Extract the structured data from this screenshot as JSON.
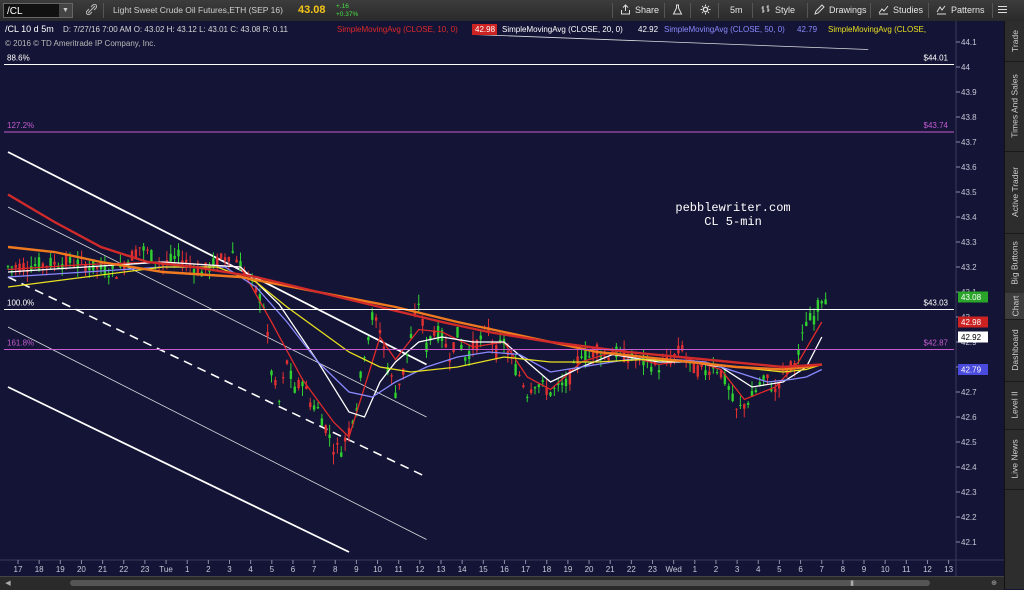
{
  "toolbar": {
    "symbol": "/CL",
    "description": "Light Sweet Crude Oil Futures,ETH (SEP 16)",
    "last": "43.08",
    "change": "+.16",
    "change_pct": "+0.37%",
    "buttons": {
      "share": "Share",
      "interval": "5m",
      "style": "Style",
      "drawings": "Drawings",
      "studies": "Studies",
      "patterns": "Patterns"
    }
  },
  "sidebar": {
    "items": [
      "Trade",
      "Times And Sales",
      "Active Trader",
      "Big Buttons",
      "Chart",
      "Dashboard",
      "Level II",
      "Live News"
    ]
  },
  "chart_data": {
    "type": "candlestick",
    "header_text": "/CL 10 d 5m",
    "ohlc": "D: 7/27/16 7:00 AM   O: 43.02   H: 43.12   L: 43.01   C: 43.08   R: 0.11",
    "copyright": "© 2016 © TD Ameritrade IP Company, Inc.",
    "annotation": [
      "pebblewriter.com",
      "CL 5-min"
    ],
    "studies": [
      {
        "label": "SimpleMovingAvg (CLOSE, 10, 0)",
        "value": "42.98",
        "color": "#e02a2a"
      },
      {
        "label": "SimpleMovingAvg (CLOSE, 20, 0)",
        "value": "42.92",
        "color": "#ffffff"
      },
      {
        "label": "SimpleMovingAvg (CLOSE, 50, 0)",
        "value": "42.79",
        "color": "#8a8aff"
      },
      {
        "label": "SimpleMovingAvg (CLOSE,",
        "value": "",
        "color": "#e8e020"
      }
    ],
    "ylim": [
      42.0,
      44.2
    ],
    "y_ticks": [
      "44.1",
      "44",
      "43.9",
      "43.8",
      "43.7",
      "43.6",
      "43.5",
      "43.4",
      "43.3",
      "43.2",
      "43.1",
      "43",
      "42.9",
      "42.8",
      "42.7",
      "42.6",
      "42.5",
      "42.4",
      "42.3",
      "42.2",
      "42.1"
    ],
    "x_ticks": [
      "17",
      "18",
      "19",
      "20",
      "21",
      "22",
      "23",
      "Tue",
      "1",
      "2",
      "3",
      "4",
      "5",
      "6",
      "7",
      "8",
      "9",
      "10",
      "11",
      "12",
      "13",
      "14",
      "15",
      "16",
      "17",
      "18",
      "19",
      "20",
      "21",
      "22",
      "23",
      "Wed",
      "1",
      "2",
      "3",
      "4",
      "5",
      "6",
      "7",
      "8",
      "9",
      "10",
      "11",
      "12",
      "13"
    ],
    "fib_levels": [
      {
        "pct": "88.6%",
        "price": "$44.01",
        "value": 44.01,
        "color": "#ffffff"
      },
      {
        "pct": "127.2%",
        "price": "$43.74",
        "value": 43.74,
        "color": "#c45ccf"
      },
      {
        "pct": "100.0%",
        "price": "$43.03",
        "value": 43.03,
        "color": "#ffffff"
      },
      {
        "pct": "161.8%",
        "price": "$42.87",
        "value": 42.87,
        "color": "#c45ccf"
      }
    ],
    "price_markers": [
      {
        "value": 43.08,
        "label": "43.08",
        "bg": "#2aa52a",
        "fg": "#ffffff"
      },
      {
        "value": 42.98,
        "label": "42.98",
        "bg": "#cc2222",
        "fg": "#ffffff"
      },
      {
        "value": 42.92,
        "label": "42.92",
        "bg": "#ffffff",
        "fg": "#000000"
      },
      {
        "value": 42.79,
        "label": "42.79",
        "bg": "#4a4adf",
        "fg": "#ffffff"
      }
    ],
    "close_path": [
      [
        0,
        43.2
      ],
      [
        8,
        43.22
      ],
      [
        14,
        43.18
      ],
      [
        17,
        43.28
      ],
      [
        20,
        43.21
      ],
      [
        22,
        43.24
      ],
      [
        25,
        43.18
      ],
      [
        29,
        43.26
      ],
      [
        31,
        43.16
      ],
      [
        33,
        43.05
      ],
      [
        34,
        42.78
      ],
      [
        35,
        42.66
      ],
      [
        36,
        42.82
      ],
      [
        37,
        42.7
      ],
      [
        38,
        42.75
      ],
      [
        39,
        42.66
      ],
      [
        40,
        42.63
      ],
      [
        41,
        42.56
      ],
      [
        42,
        42.48
      ],
      [
        43,
        42.47
      ],
      [
        44,
        42.55
      ],
      [
        45,
        42.65
      ],
      [
        46,
        42.86
      ],
      [
        47,
        43.0
      ],
      [
        48,
        42.95
      ],
      [
        49,
        42.8
      ],
      [
        50,
        42.7
      ],
      [
        51,
        42.78
      ],
      [
        52,
        42.92
      ],
      [
        53,
        43.06
      ],
      [
        54,
        42.88
      ],
      [
        55,
        42.95
      ],
      [
        56,
        42.92
      ],
      [
        57,
        42.85
      ],
      [
        58,
        42.93
      ],
      [
        59,
        42.84
      ],
      [
        60,
        42.88
      ],
      [
        61,
        42.91
      ],
      [
        62,
        42.95
      ],
      [
        63,
        42.86
      ],
      [
        64,
        42.9
      ],
      [
        65,
        42.82
      ],
      [
        66,
        42.77
      ],
      [
        67,
        42.7
      ],
      [
        68,
        42.74
      ],
      [
        70,
        42.7
      ],
      [
        72,
        42.73
      ],
      [
        73,
        42.79
      ],
      [
        74,
        42.86
      ],
      [
        75,
        42.84
      ],
      [
        76,
        42.88
      ],
      [
        77,
        42.84
      ],
      [
        78,
        42.86
      ],
      [
        80,
        42.84
      ],
      [
        82,
        42.82
      ],
      [
        84,
        42.8
      ],
      [
        86,
        42.84
      ],
      [
        87,
        42.88
      ],
      [
        88,
        42.8
      ],
      [
        90,
        42.78
      ],
      [
        91,
        42.81
      ],
      [
        92,
        42.78
      ],
      [
        93,
        42.71
      ],
      [
        94,
        42.62
      ],
      [
        95,
        42.65
      ],
      [
        96,
        42.68
      ],
      [
        97,
        42.73
      ],
      [
        98,
        42.75
      ],
      [
        99,
        42.7
      ],
      [
        100,
        42.78
      ],
      [
        101,
        42.8
      ],
      [
        102,
        42.85
      ],
      [
        103,
        42.98
      ],
      [
        104,
        43.0
      ],
      [
        105,
        43.08
      ]
    ],
    "moving_averages": [
      {
        "name": "SMA 10",
        "color": "#e02a2a",
        "points": [
          [
            0,
            43.19
          ],
          [
            10,
            43.21
          ],
          [
            20,
            43.22
          ],
          [
            30,
            43.2
          ],
          [
            34,
            42.98
          ],
          [
            38,
            42.75
          ],
          [
            42,
            42.58
          ],
          [
            44,
            42.52
          ],
          [
            46,
            42.72
          ],
          [
            48,
            42.92
          ],
          [
            50,
            42.83
          ],
          [
            53,
            42.95
          ],
          [
            56,
            42.94
          ],
          [
            60,
            42.88
          ],
          [
            64,
            42.9
          ],
          [
            67,
            42.76
          ],
          [
            70,
            42.71
          ],
          [
            74,
            42.82
          ],
          [
            78,
            42.86
          ],
          [
            84,
            42.81
          ],
          [
            88,
            42.83
          ],
          [
            92,
            42.79
          ],
          [
            95,
            42.67
          ],
          [
            99,
            42.72
          ],
          [
            102,
            42.82
          ],
          [
            105,
            42.98
          ]
        ]
      },
      {
        "name": "SMA 20",
        "color": "#ffffff",
        "points": [
          [
            0,
            43.18
          ],
          [
            10,
            43.2
          ],
          [
            20,
            43.22
          ],
          [
            30,
            43.2
          ],
          [
            35,
            43.05
          ],
          [
            40,
            42.82
          ],
          [
            44,
            42.62
          ],
          [
            46,
            42.6
          ],
          [
            48,
            42.74
          ],
          [
            50,
            42.82
          ],
          [
            53,
            42.9
          ],
          [
            56,
            42.92
          ],
          [
            60,
            42.9
          ],
          [
            64,
            42.9
          ],
          [
            67,
            42.82
          ],
          [
            70,
            42.74
          ],
          [
            74,
            42.8
          ],
          [
            78,
            42.85
          ],
          [
            84,
            42.82
          ],
          [
            88,
            42.82
          ],
          [
            92,
            42.8
          ],
          [
            96,
            42.72
          ],
          [
            100,
            42.74
          ],
          [
            103,
            42.8
          ],
          [
            105,
            42.92
          ]
        ]
      },
      {
        "name": "SMA 50",
        "color": "#8a8aff",
        "points": [
          [
            0,
            43.16
          ],
          [
            10,
            43.18
          ],
          [
            20,
            43.2
          ],
          [
            28,
            43.2
          ],
          [
            32,
            43.12
          ],
          [
            36,
            42.98
          ],
          [
            40,
            42.82
          ],
          [
            44,
            42.7
          ],
          [
            47,
            42.68
          ],
          [
            50,
            42.74
          ],
          [
            54,
            42.8
          ],
          [
            58,
            42.84
          ],
          [
            62,
            42.86
          ],
          [
            66,
            42.85
          ],
          [
            70,
            42.78
          ],
          [
            74,
            42.8
          ],
          [
            80,
            42.83
          ],
          [
            86,
            42.83
          ],
          [
            90,
            42.82
          ],
          [
            94,
            42.78
          ],
          [
            98,
            42.74
          ],
          [
            101,
            42.75
          ],
          [
            103,
            42.76
          ],
          [
            105,
            42.79
          ]
        ]
      },
      {
        "name": "SMA yellow",
        "color": "#e8e020",
        "points": [
          [
            0,
            43.12
          ],
          [
            10,
            43.16
          ],
          [
            20,
            43.2
          ],
          [
            27,
            43.2
          ],
          [
            32,
            43.14
          ],
          [
            36,
            43.04
          ],
          [
            40,
            42.95
          ],
          [
            44,
            42.86
          ],
          [
            48,
            42.8
          ],
          [
            52,
            42.78
          ],
          [
            58,
            42.8
          ],
          [
            64,
            42.84
          ],
          [
            70,
            42.82
          ],
          [
            76,
            42.82
          ],
          [
            82,
            42.83
          ],
          [
            88,
            42.82
          ],
          [
            94,
            42.8
          ],
          [
            100,
            42.78
          ],
          [
            103,
            42.79
          ],
          [
            105,
            42.81
          ]
        ]
      },
      {
        "name": "SMA orange",
        "color": "#f07a20",
        "points": [
          [
            0,
            43.28
          ],
          [
            6,
            43.26
          ],
          [
            12,
            43.22
          ],
          [
            20,
            43.18
          ],
          [
            30,
            43.16
          ],
          [
            40,
            43.1
          ],
          [
            50,
            43.04
          ],
          [
            58,
            42.98
          ],
          [
            64,
            42.94
          ],
          [
            70,
            42.9
          ],
          [
            76,
            42.86
          ],
          [
            82,
            42.84
          ],
          [
            88,
            42.82
          ],
          [
            94,
            42.8
          ],
          [
            100,
            42.79
          ],
          [
            103,
            42.8
          ],
          [
            105,
            42.81
          ]
        ]
      },
      {
        "name": "SMA red",
        "color": "#d02a2a",
        "points": [
          [
            0,
            43.49
          ],
          [
            6,
            43.38
          ],
          [
            12,
            43.28
          ],
          [
            18,
            43.22
          ],
          [
            24,
            43.2
          ],
          [
            32,
            43.16
          ],
          [
            40,
            43.1
          ],
          [
            48,
            43.04
          ],
          [
            56,
            42.98
          ],
          [
            62,
            42.94
          ],
          [
            70,
            42.9
          ],
          [
            80,
            42.86
          ],
          [
            90,
            42.83
          ],
          [
            100,
            42.8
          ],
          [
            105,
            42.81
          ]
        ]
      }
    ],
    "trend_lines": [
      {
        "kind": "solid",
        "color": "#ffffff",
        "points": [
          [
            0,
            43.66
          ],
          [
            54,
            42.81
          ]
        ]
      },
      {
        "kind": "thin",
        "color": "#ffffff",
        "points": [
          [
            0,
            43.44
          ],
          [
            54,
            42.6
          ]
        ]
      },
      {
        "kind": "dashed",
        "color": "#ffffff",
        "points": [
          [
            0,
            43.16
          ],
          [
            54,
            42.36
          ]
        ]
      },
      {
        "kind": "thin",
        "color": "#ffffff",
        "points": [
          [
            0,
            42.96
          ],
          [
            54,
            42.11
          ]
        ]
      },
      {
        "kind": "solid",
        "color": "#ffffff",
        "points": [
          [
            0,
            42.72
          ],
          [
            44,
            42.06
          ]
        ]
      },
      {
        "kind": "thin",
        "color": "#ffffff",
        "points": [
          [
            60,
            44.13
          ],
          [
            111,
            44.07
          ]
        ]
      }
    ]
  }
}
